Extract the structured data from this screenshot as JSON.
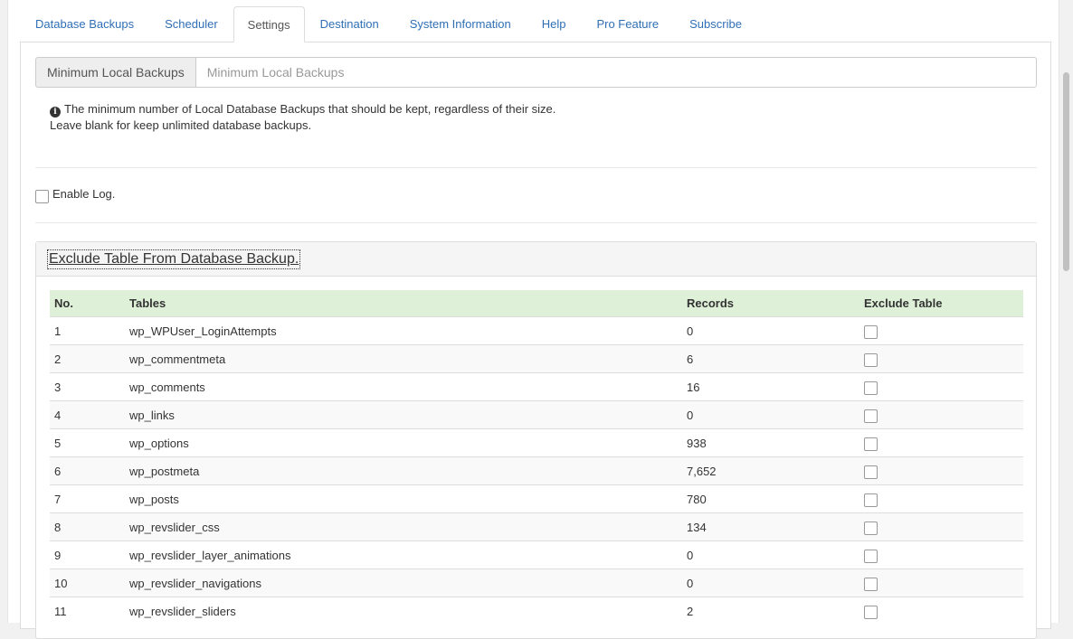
{
  "tabs": [
    {
      "label": "Database Backups",
      "active": false
    },
    {
      "label": "Scheduler",
      "active": false
    },
    {
      "label": "Settings",
      "active": true
    },
    {
      "label": "Destination",
      "active": false
    },
    {
      "label": "System Information",
      "active": false
    },
    {
      "label": "Help",
      "active": false
    },
    {
      "label": "Pro Feature",
      "active": false
    },
    {
      "label": "Subscribe",
      "active": false
    }
  ],
  "min_backups": {
    "label": "Minimum Local Backups",
    "placeholder": "Minimum Local Backups",
    "value": "",
    "help_line1": "The minimum number of Local Database Backups that should be kept, regardless of their size.",
    "help_line2": "Leave blank for keep unlimited database backups.",
    "info_icon": "info-circle-icon"
  },
  "enable_log": {
    "label": "Enable Log.",
    "checked": false
  },
  "exclude": {
    "heading": "Exclude Table From Database Backup.",
    "columns": [
      "No.",
      "Tables",
      "Records",
      "Exclude Table"
    ],
    "rows": [
      {
        "no": "1",
        "table": "wp_WPUser_LoginAttempts",
        "records": "0"
      },
      {
        "no": "2",
        "table": "wp_commentmeta",
        "records": "6"
      },
      {
        "no": "3",
        "table": "wp_comments",
        "records": "16"
      },
      {
        "no": "4",
        "table": "wp_links",
        "records": "0"
      },
      {
        "no": "5",
        "table": "wp_options",
        "records": "938"
      },
      {
        "no": "6",
        "table": "wp_postmeta",
        "records": "7,652"
      },
      {
        "no": "7",
        "table": "wp_posts",
        "records": "780"
      },
      {
        "no": "8",
        "table": "wp_revslider_css",
        "records": "134"
      },
      {
        "no": "9",
        "table": "wp_revslider_layer_animations",
        "records": "0"
      },
      {
        "no": "10",
        "table": "wp_revslider_navigations",
        "records": "0"
      },
      {
        "no": "11",
        "table": "wp_revslider_sliders",
        "records": "2"
      }
    ]
  }
}
